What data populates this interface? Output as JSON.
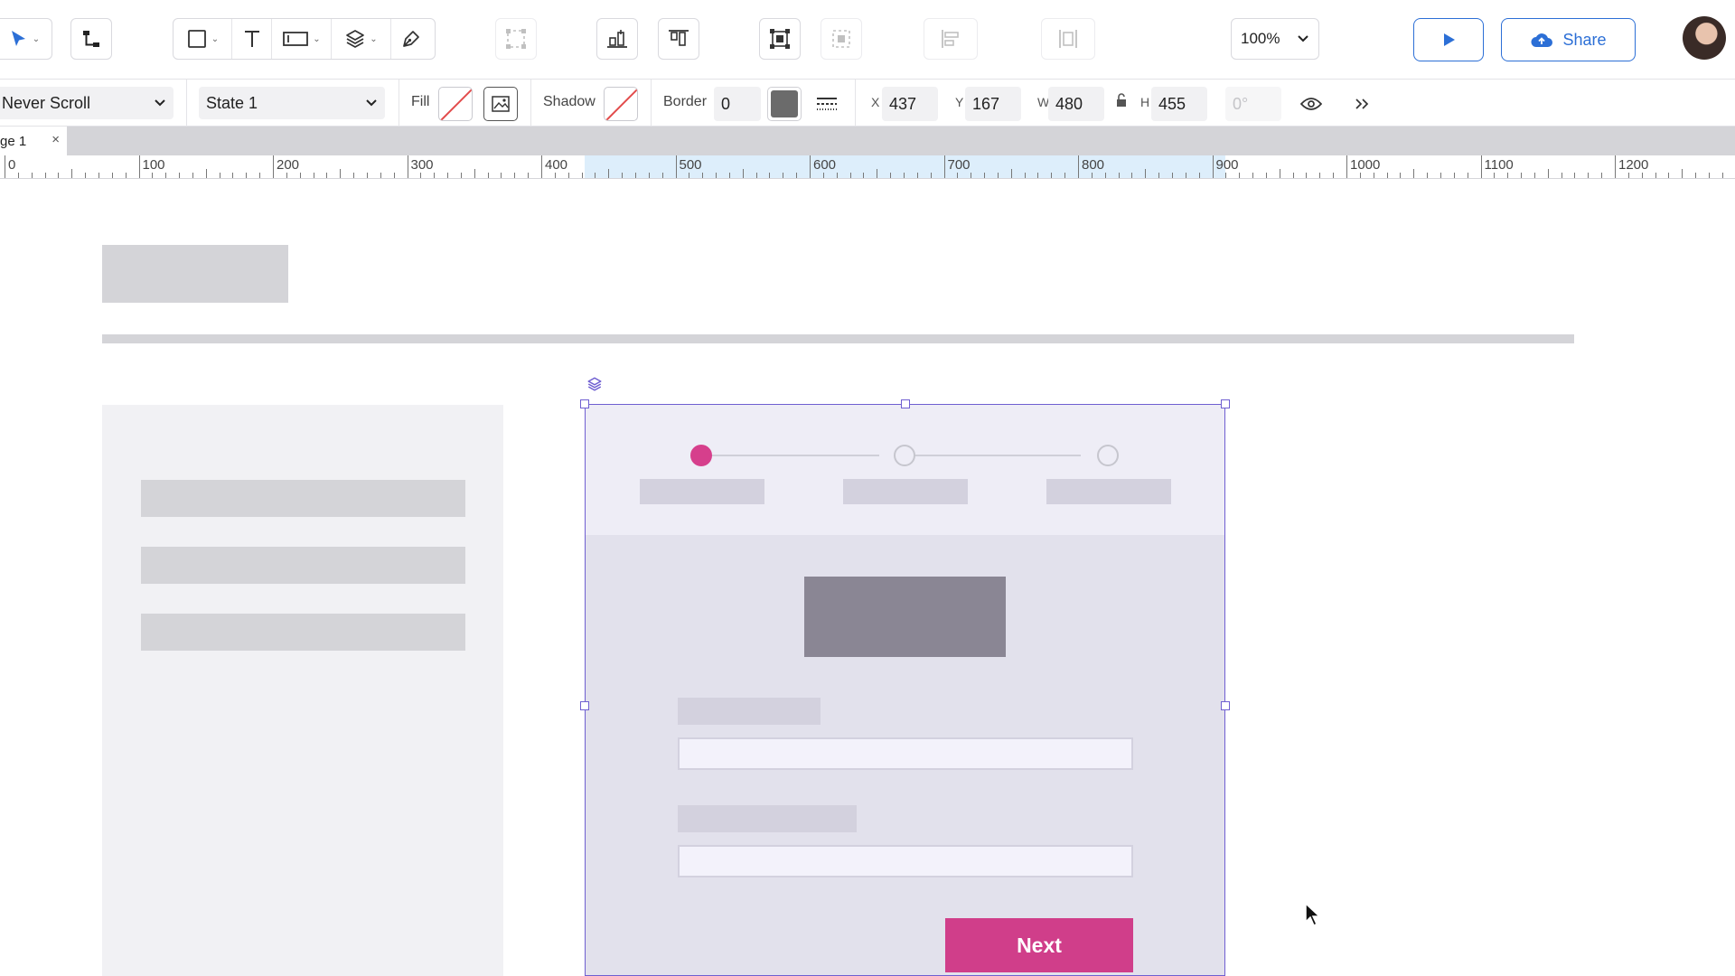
{
  "toolbar": {
    "zoom": "100%",
    "share_label": "Share",
    "accent": "#2c6fd6"
  },
  "properties": {
    "scroll_mode": "Never Scroll",
    "state": "State 1",
    "fill_label": "Fill",
    "shadow_label": "Shadow",
    "border_label": "Border",
    "border_width": "0",
    "border_color": "#6b6b6b",
    "x_label": "X",
    "x": "437",
    "y_label": "Y",
    "y": "167",
    "w_label": "W",
    "w": "480",
    "h_label": "H",
    "h": "455",
    "rotation": "0°"
  },
  "pages": {
    "active_tab": "ge 1"
  },
  "ruler": {
    "labels": [
      "0",
      "100",
      "200",
      "300",
      "400",
      "500",
      "600",
      "700",
      "800",
      "900",
      "1000",
      "1100",
      "1200"
    ]
  },
  "canvas": {
    "stepper": {
      "steps": 3,
      "active_step": 1,
      "active_color": "#d63f8c"
    },
    "next_label": "Next",
    "button_color": "#d03e8a",
    "selection_color": "#6f5fd1"
  }
}
